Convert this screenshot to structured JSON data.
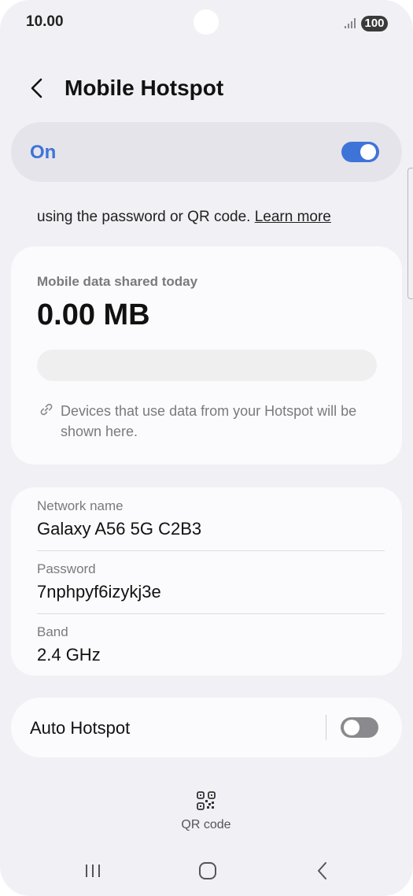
{
  "status_bar": {
    "time": "10.00",
    "battery": "100"
  },
  "header": {
    "title": "Mobile Hotspot"
  },
  "hotspot_toggle": {
    "label": "On",
    "state": "on",
    "accent_color": "#3e74d8"
  },
  "description": {
    "text": "using the password or QR code.",
    "link": "Learn more"
  },
  "data_usage": {
    "label": "Mobile data shared today",
    "value": "0.00 MB",
    "progress_fraction": 0,
    "devices_text": "Devices that use data from your Hotspot will be shown here."
  },
  "network": {
    "name_label": "Network name",
    "name_value": "Galaxy A56 5G C2B3",
    "password_label": "Password",
    "password_value": "7nphpyf6izykj3e",
    "band_label": "Band",
    "band_value": "2.4 GHz"
  },
  "auto_hotspot": {
    "label": "Auto Hotspot",
    "state": "off"
  },
  "bottom_action": {
    "label": "QR code"
  },
  "icons": {
    "back": "back-arrow-icon",
    "link": "link-icon",
    "qr": "qr-code-icon",
    "recents": "recents-icon",
    "home": "home-icon",
    "nav_back": "nav-back-icon"
  }
}
